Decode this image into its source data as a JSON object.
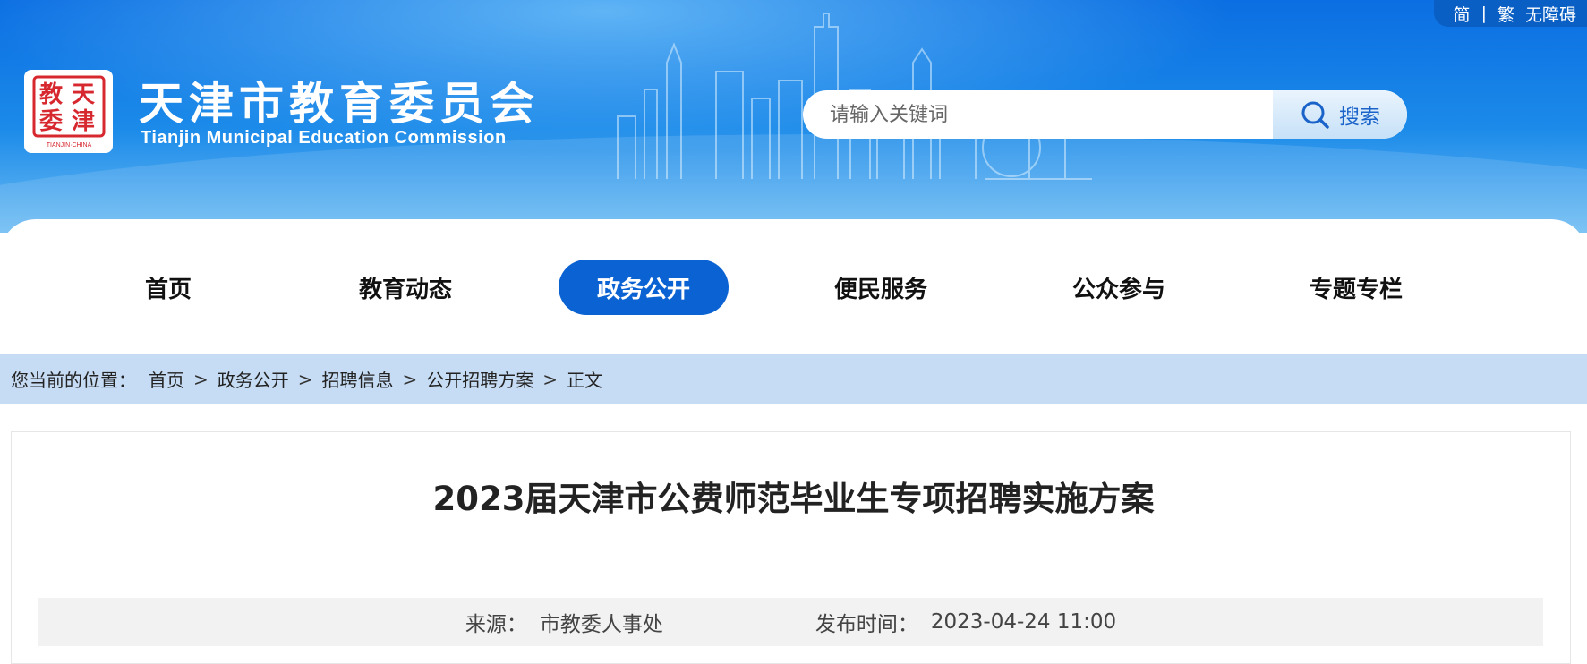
{
  "lang": {
    "simplified": "简",
    "separator": "|",
    "traditional": "繁",
    "accessibility": "无障碍"
  },
  "logo": {
    "title": "天津市教育委员会",
    "subtitle": "Tianjin Municipal Education Commission",
    "seal_glyphs": [
      "天",
      "津",
      "教",
      "委"
    ],
    "seal_caption": "TIANJIN·CHINA",
    "seal_color": "#d6282e"
  },
  "search": {
    "placeholder": "请输入关键词",
    "button_label": "搜索"
  },
  "nav": {
    "items": [
      {
        "label": "首页"
      },
      {
        "label": "教育动态"
      },
      {
        "label": "政务公开"
      },
      {
        "label": "便民服务"
      },
      {
        "label": "公众参与"
      },
      {
        "label": "专题专栏"
      }
    ],
    "active_index": 2,
    "active_color": "#0b63d3"
  },
  "breadcrumb": {
    "lead": "您当前的位置：",
    "items": [
      "首页",
      "政务公开",
      "招聘信息",
      "公开招聘方案",
      "正文"
    ],
    "separator": ">"
  },
  "article": {
    "title": "2023届天津市公费师范毕业生专项招聘实施方案",
    "source_label": "来源：",
    "source_value": "市教委人事处",
    "date_label": "发布时间：",
    "date_value": "2023-04-24 11:00"
  },
  "colors": {
    "banner": "#0b6ee2",
    "breadcrumb_bg": "#c6dcf4"
  }
}
